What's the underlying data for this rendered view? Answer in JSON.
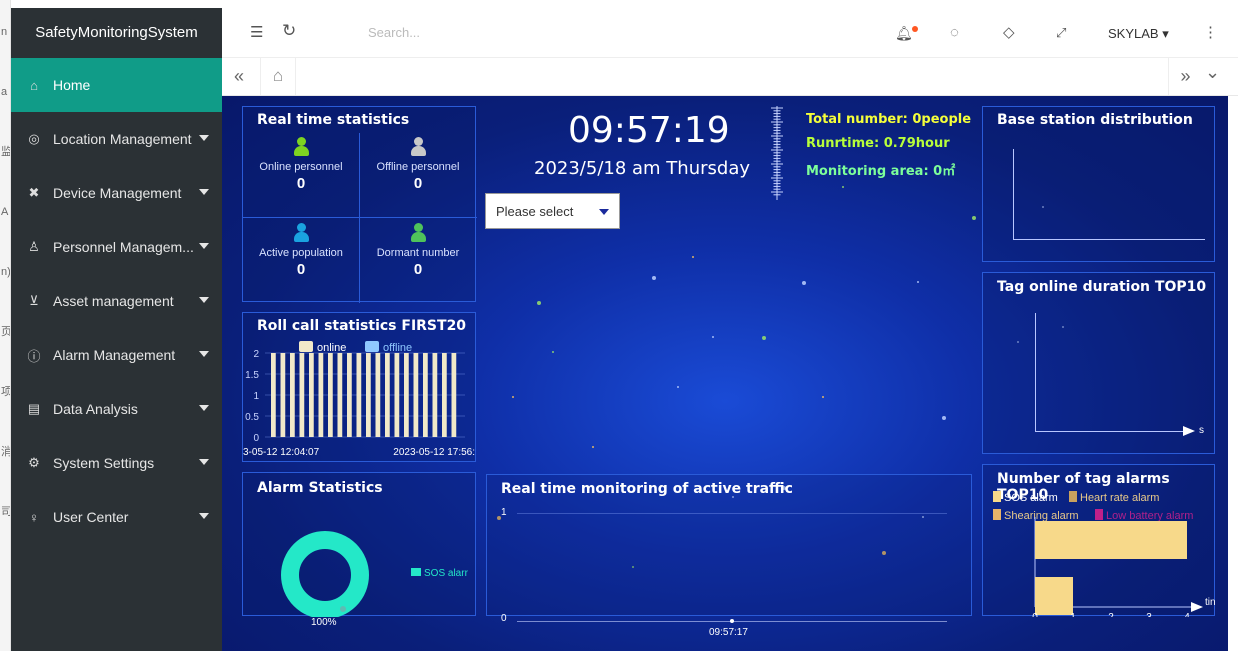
{
  "left_strip": {
    "chars": [
      "n",
      "a",
      "监",
      "A",
      "n)",
      "页",
      "项",
      "消",
      "司"
    ]
  },
  "sidebar": {
    "brand": "SafetyMonitoringSystem",
    "items": [
      {
        "label": "Home",
        "icon": "home-icon",
        "glyph": "⌂",
        "active": true,
        "has_caret": false
      },
      {
        "label": "Location Management",
        "icon": "location-icon",
        "glyph": "◎",
        "active": false,
        "has_caret": true
      },
      {
        "label": "Device Management",
        "icon": "device-icon",
        "glyph": "✖",
        "active": false,
        "has_caret": true
      },
      {
        "label": "Personnel Managem...",
        "icon": "personnel-icon",
        "glyph": "♙",
        "active": false,
        "has_caret": true
      },
      {
        "label": "Asset management",
        "icon": "cart-icon",
        "glyph": "⊻",
        "active": false,
        "has_caret": true
      },
      {
        "label": "Alarm Management",
        "icon": "alarm-info-icon",
        "glyph": "ⓘ",
        "active": false,
        "has_caret": true
      },
      {
        "label": "Data Analysis",
        "icon": "data-icon",
        "glyph": "▤",
        "active": false,
        "has_caret": true
      },
      {
        "label": "System Settings",
        "icon": "gear-icon",
        "glyph": "⚙",
        "active": false,
        "has_caret": true
      },
      {
        "label": "User Center",
        "icon": "user-icon",
        "glyph": "♀",
        "active": false,
        "has_caret": true
      }
    ],
    "active_color": "#109c88"
  },
  "topbar": {
    "search_placeholder": "Search...",
    "user": "SKYLAB",
    "icons": {
      "menu": "☰",
      "refresh": "↻",
      "bell": "🔔︎",
      "theme": "◌",
      "tag": "◇",
      "fullscreen": "⤢",
      "more": "⋮"
    }
  },
  "tabbar": {
    "prev": "«",
    "home": "⌂",
    "next": "»",
    "down": "⌄"
  },
  "dashboard": {
    "real_time": {
      "title": "Real time statistics",
      "cells": [
        {
          "label": "Online personnel",
          "value": "0",
          "color": "#7ed321"
        },
        {
          "label": "Offline personnel",
          "value": "0",
          "color": "#c8c8c8"
        },
        {
          "label": "Active population",
          "value": "0",
          "color": "#1aa3e0"
        },
        {
          "label": "Dormant number",
          "value": "0",
          "color": "#4fc35b"
        }
      ]
    },
    "clock": {
      "time": "09:57:19",
      "date": "2023/5/18  am  Thursday"
    },
    "select": {
      "value": "Please select"
    },
    "info": {
      "total": "Total number: 0people",
      "runtime": "Runrtime:  0.79hour",
      "area": "Monitoring area:  0㎡",
      "total_color": "#f5ff3a",
      "runtime_color": "#b8ff3a",
      "area_color": "#7dff9a"
    },
    "roll_call": {
      "title": "Roll call statistics FIRST20",
      "legend": [
        "online",
        "offline"
      ],
      "legend_colors": [
        "#f1e9c9",
        "#8fc7ff"
      ],
      "y_ticks": [
        "2",
        "1.5",
        "1",
        "0.5",
        "0"
      ],
      "x_left": "3-05-12 12:04:07",
      "x_right": "2023-05-12 17:56:"
    },
    "alarm_stats": {
      "title": "Alarm Statistics",
      "percent": "100%",
      "legend": "SOS alarr",
      "ring_color": "#24e8c8"
    },
    "traffic": {
      "title": "Real time monitoring of active traffic",
      "y_top": "1",
      "y_bottom": "0",
      "x_label": "09:57:17"
    },
    "base_station": {
      "title": "Base station distribution"
    },
    "tag_online": {
      "title": "Tag online duration TOP10",
      "x_unit": "s"
    },
    "tag_alarms": {
      "title": "Number of tag alarms TOP10",
      "legend": [
        {
          "label": "SOS alarm",
          "color": "#f7d98a"
        },
        {
          "label": "Heart rate alarm",
          "color": "#c9a15e"
        },
        {
          "label": "Shearing alarm",
          "color": "#e8b46a"
        },
        {
          "label": "Low battery alarm",
          "color": "#c0208a"
        }
      ],
      "x_ticks": [
        "0",
        "1",
        "2",
        "3",
        "4"
      ],
      "x_unit": "tin"
    }
  },
  "chart_data": [
    {
      "type": "bar",
      "title": "Roll call statistics FIRST20",
      "series": [
        {
          "name": "online",
          "values": [
            2,
            2,
            2,
            2,
            2,
            2,
            2,
            2,
            2,
            2,
            2,
            2,
            2,
            2,
            2,
            2,
            2,
            2,
            2,
            2
          ]
        },
        {
          "name": "offline",
          "values": [
            0,
            0,
            0,
            0,
            0,
            0,
            0,
            0,
            0,
            0,
            0,
            0,
            0,
            0,
            0,
            0,
            0,
            0,
            0,
            0
          ]
        }
      ],
      "ylim": [
        0,
        2
      ]
    },
    {
      "type": "bar",
      "title": "Number of tag alarms TOP10",
      "series": [
        {
          "name": "SOS alarm",
          "values": [
            4,
            1
          ]
        }
      ],
      "xlim": [
        0,
        4
      ]
    },
    {
      "type": "pie",
      "title": "Alarm Statistics",
      "categories": [
        "SOS alarr"
      ],
      "values": [
        100
      ]
    }
  ]
}
